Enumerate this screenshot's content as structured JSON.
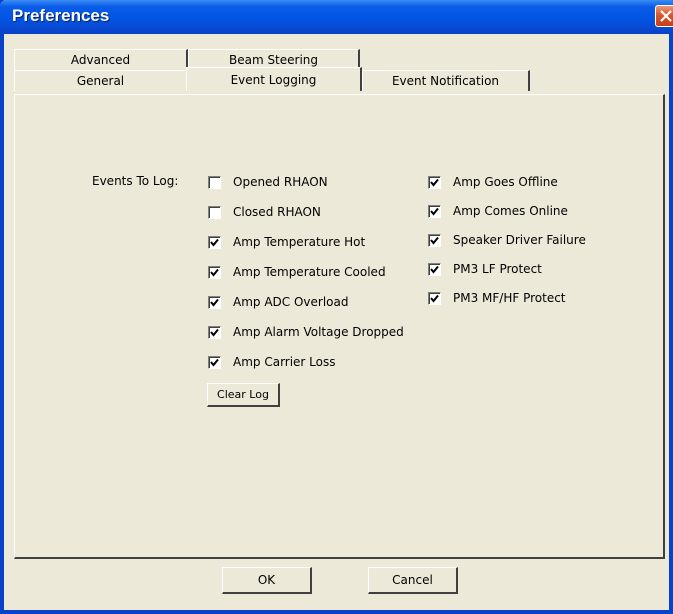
{
  "window": {
    "title": "Preferences"
  },
  "tabs": {
    "row_back": [
      "Advanced",
      "Beam Steering"
    ],
    "row_front": [
      "General",
      "Event Logging",
      "Event Notification"
    ],
    "active": "Event Logging"
  },
  "events": {
    "label": "Events To Log:",
    "left_column": [
      {
        "label": "Opened RHAON",
        "checked": false
      },
      {
        "label": "Closed RHAON",
        "checked": false
      },
      {
        "label": "Amp Temperature Hot",
        "checked": true
      },
      {
        "label": "Amp Temperature Cooled",
        "checked": true
      },
      {
        "label": "Amp ADC Overload",
        "checked": true
      },
      {
        "label": "Amp Alarm Voltage Dropped",
        "checked": true
      },
      {
        "label": "Amp Carrier Loss",
        "checked": true
      }
    ],
    "right_column": [
      {
        "label": "Amp Goes Offline",
        "checked": true
      },
      {
        "label": "Amp Comes Online",
        "checked": true
      },
      {
        "label": "Speaker Driver Failure",
        "checked": true
      },
      {
        "label": "PM3 LF Protect",
        "checked": true
      },
      {
        "label": "PM3 MF/HF Protect",
        "checked": true
      }
    ],
    "clear_log_label": "Clear Log"
  },
  "buttons": {
    "ok_label": "OK",
    "cancel_label": "Cancel"
  },
  "colors": {
    "titlebar": "#0054e3",
    "face": "#ece9d8",
    "close": "#d9552b"
  }
}
